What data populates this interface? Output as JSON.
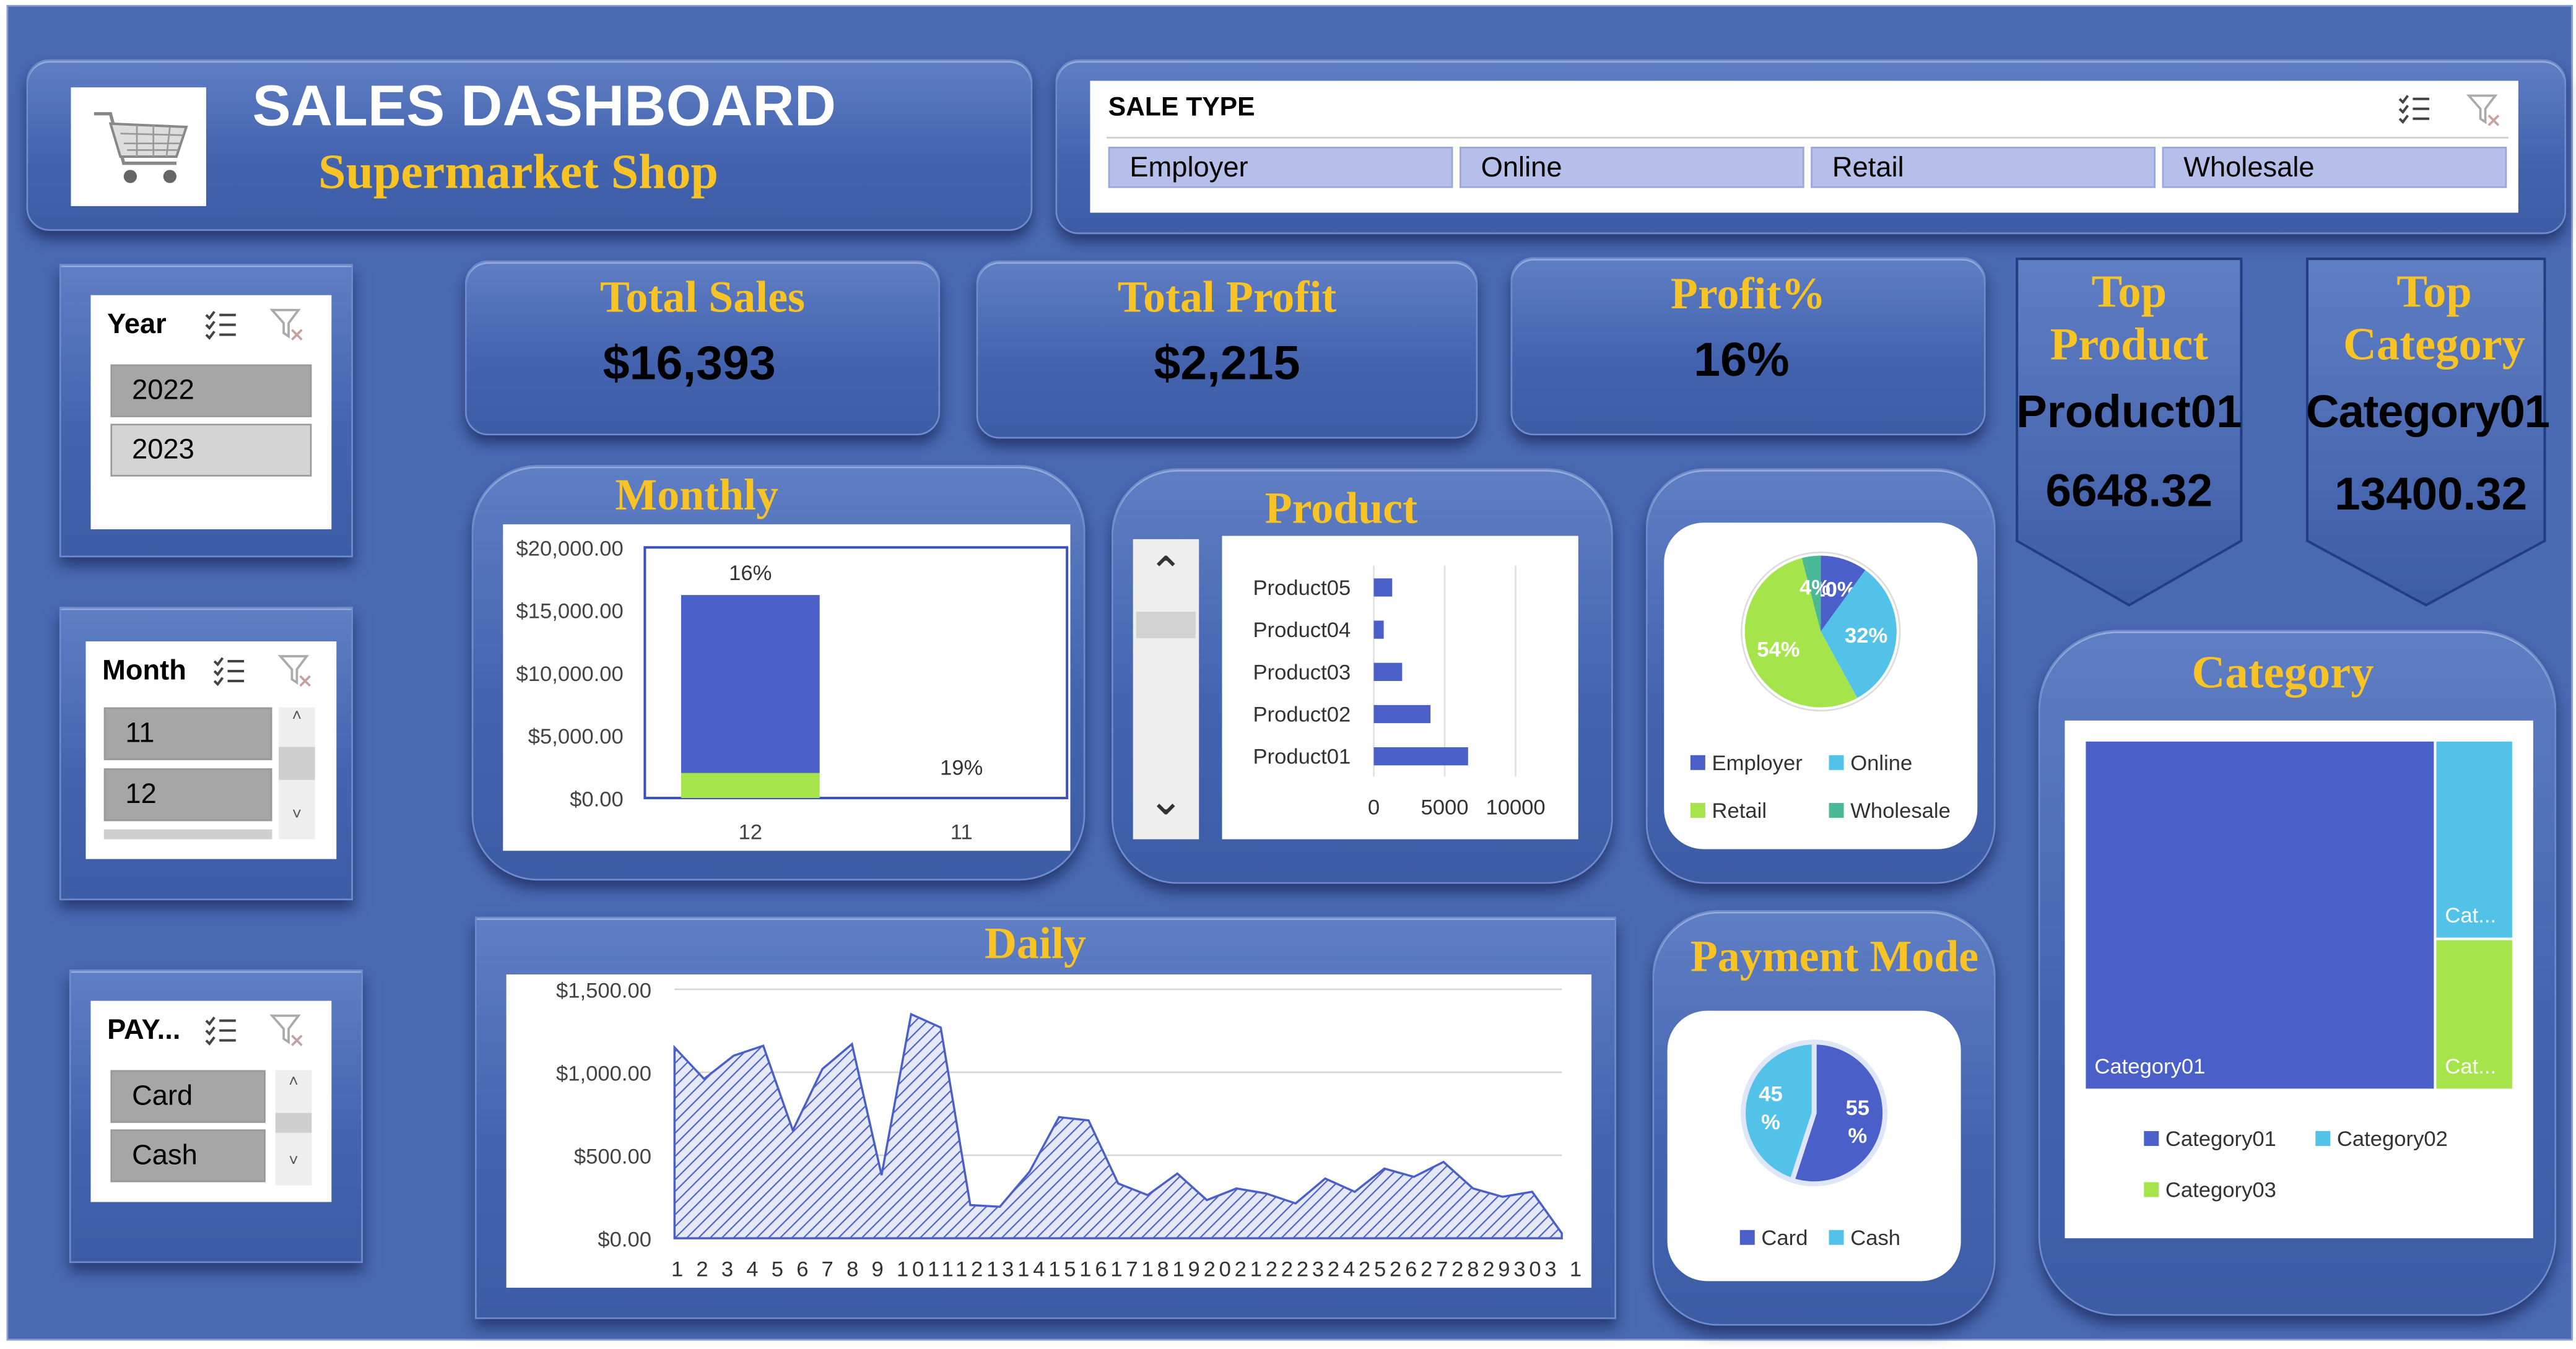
{
  "header": {
    "title": "SALES DASHBOARD",
    "subtitle": "Supermarket Shop"
  },
  "sale_type": {
    "title": "SALE TYPE",
    "options": [
      "Employer",
      "Online",
      "Retail",
      "Wholesale"
    ]
  },
  "slicers": {
    "year": {
      "title": "Year",
      "items": [
        "2022",
        "2023"
      ]
    },
    "month": {
      "title": "Month",
      "items": [
        "11",
        "12"
      ]
    },
    "payment": {
      "title": "PAY...",
      "items": [
        "Card",
        "Cash"
      ]
    }
  },
  "kpis": {
    "total_sales": {
      "label": "Total Sales",
      "value": "$16,393"
    },
    "total_profit": {
      "label": "Total Profit",
      "value": "$2,215"
    },
    "profit_pct": {
      "label": "Profit%",
      "value": "16%"
    },
    "top_product": {
      "label_line1": "Top",
      "label_line2": "Product",
      "name": "Product01",
      "value": "6648.32"
    },
    "top_category": {
      "label_line1": "Top",
      "label_line2": "Category",
      "name": "Category01",
      "value": "13400.32"
    }
  },
  "colors": {
    "dark_blue": "#4a5fc8",
    "light_blue": "#52c2e8",
    "green": "#a6e44b",
    "teal": "#49b996",
    "gold": "#f7c325"
  },
  "chart_data": [
    {
      "id": "monthly",
      "title": "Monthly",
      "type": "bar",
      "stacked": true,
      "categories": [
        "12",
        "11"
      ],
      "series": [
        {
          "color": "#a6e44b",
          "values": [
            2000,
            0
          ]
        },
        {
          "color": "#4a5fc8",
          "values": [
            14200,
            0
          ]
        }
      ],
      "data_labels": [
        "16%",
        "19%"
      ],
      "ylim": [
        0,
        20000
      ],
      "yticks": [
        "$0.00",
        "$5,000.00",
        "$10,000.00",
        "$15,000.00",
        "$20,000.00"
      ],
      "grid": false
    },
    {
      "id": "product",
      "title": "Product",
      "type": "bar",
      "orientation": "horizontal",
      "categories": [
        "Product05",
        "Product04",
        "Product03",
        "Product02",
        "Product01"
      ],
      "values": [
        1300,
        700,
        2000,
        4000,
        6648.32
      ],
      "xlim": [
        0,
        10000
      ],
      "xticks": [
        "0",
        "5000",
        "10000"
      ],
      "grid": true
    },
    {
      "id": "sale_type_share",
      "type": "pie",
      "categories": [
        "Employer",
        "Online",
        "Retail",
        "Wholesale"
      ],
      "values": [
        10,
        32,
        54,
        4
      ],
      "labels": [
        "10%",
        "32%",
        "54%",
        "4%"
      ],
      "legend": "bottom"
    },
    {
      "id": "daily",
      "title": "Daily",
      "type": "area",
      "x": [
        "1",
        "2",
        "3",
        "4",
        "5",
        "6",
        "7",
        "8",
        "9",
        "10",
        "11",
        "12",
        "13",
        "14",
        "15",
        "16",
        "17",
        "18",
        "19",
        "20",
        "21",
        "22",
        "23",
        "24",
        "25",
        "26",
        "27",
        "28",
        "29",
        "30",
        "31"
      ],
      "x_tick_text": "1 2 3 4 5 6 7 8 9 1011121314151617181920212223242526272829303 1",
      "values": [
        1150,
        960,
        1100,
        1160,
        650,
        1020,
        1170,
        380,
        1350,
        1270,
        200,
        190,
        400,
        730,
        710,
        330,
        260,
        390,
        230,
        300,
        270,
        210,
        360,
        280,
        420,
        370,
        460,
        300,
        250,
        280,
        30
      ],
      "ylim": [
        0,
        1500
      ],
      "yticks": [
        "$0.00",
        "$500.00",
        "$1,000.00",
        "$1,500.00"
      ],
      "grid": true
    },
    {
      "id": "payment_mode",
      "title": "Payment Mode",
      "type": "pie",
      "categories": [
        "Card",
        "Cash"
      ],
      "values": [
        55,
        45
      ],
      "labels": [
        "55\n%",
        "45\n%"
      ],
      "legend": "bottom"
    },
    {
      "id": "category",
      "title": "Category",
      "type": "treemap",
      "categories": [
        "Category01",
        "Category02",
        "Category03"
      ],
      "values": [
        13400.32,
        1700,
        1292.68
      ],
      "tile_labels": [
        "Category01",
        "Cat...",
        "Cat..."
      ],
      "legend": "bottom"
    }
  ]
}
